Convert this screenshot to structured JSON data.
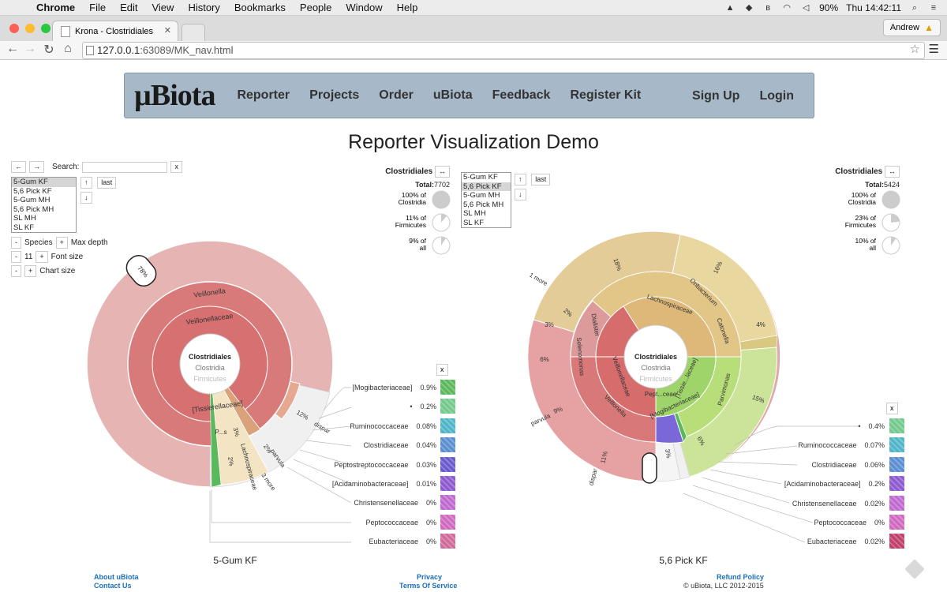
{
  "os_menubar": {
    "app": "Chrome",
    "menus": [
      "Chrome",
      "File",
      "Edit",
      "View",
      "History",
      "Bookmarks",
      "People",
      "Window",
      "Help"
    ],
    "battery": "90%",
    "clock": "Thu 14:42:11"
  },
  "browser": {
    "tab_title": "Krona - Clostridiales",
    "profile": "Andrew",
    "url_host": "127.0.0.1",
    "url_path": ":63089/MK_nav.html"
  },
  "site_nav": {
    "logo": "µBiota",
    "links": [
      "Reporter",
      "Projects",
      "Order",
      "uBiota",
      "Feedback",
      "Register Kit"
    ],
    "right_links": [
      "Sign Up",
      "Login"
    ]
  },
  "page_title": "Reporter Visualization Demo",
  "left_controls": {
    "search_label": "Search:",
    "search_value": "",
    "search_clear": "x",
    "last_button": "last",
    "datasets": [
      "5-Gum KF",
      "5,6 Pick KF",
      "5-Gum MH",
      "5,6 Pick MH",
      "SL MH",
      "SL KF"
    ],
    "species_label": "Species",
    "max_depth_label": "Max depth",
    "font_size_value": "11",
    "font_size_label": "Font size",
    "chart_size_label": "Chart size"
  },
  "left_chart": {
    "cluster": "Clostridiales",
    "total_label": "Total:",
    "total_value": "7702",
    "pie_info": [
      {
        "pct": "100% of",
        "of": "Clostridia",
        "fraction": 1.0
      },
      {
        "pct": "11% of",
        "of": "Firmicutes",
        "fraction": 0.11
      },
      {
        "pct": "9% of",
        "of": "all",
        "fraction": 0.09
      }
    ],
    "center_labels": [
      "Clostridiales",
      "Clostridia",
      "Firmicutes"
    ],
    "ring_labels": [
      "Veillonella",
      "Veillonellaceae",
      "[Tissierellaceae]",
      "P...s",
      "3%",
      "2%",
      "Lachnospiraceae",
      "2%",
      "parvula",
      "3 more",
      "12%",
      "dispar",
      "78%"
    ],
    "caption": "5-Gum KF",
    "legend_close": "x",
    "legend": [
      {
        "name": "[Mogibacteriaceae]",
        "pct": "0.9%",
        "color": "#5cb85c"
      },
      {
        "name": "•",
        "pct": "0.2%",
        "color": "#74c98d"
      },
      {
        "name": "Ruminococcaceae",
        "pct": "0.08%",
        "color": "#4fb6c9"
      },
      {
        "name": "Clostridiaceae",
        "pct": "0.04%",
        "color": "#5b8fd0"
      },
      {
        "name": "Peptostreptococcaceae",
        "pct": "0.03%",
        "color": "#6a5acd"
      },
      {
        "name": "[Acidaminobacteraceae]",
        "pct": "0.01%",
        "color": "#8e5ad0"
      },
      {
        "name": "Christensenellaceae",
        "pct": "0%",
        "color": "#c06ad0"
      },
      {
        "name": "Peptococcaceae",
        "pct": "0%",
        "color": "#d06ac0"
      },
      {
        "name": "Eubacteriaceae",
        "pct": "0%",
        "color": "#d06a9a"
      }
    ]
  },
  "right_controls": {
    "datasets": [
      "5-Gum KF",
      "5,6 Pick KF",
      "5-Gum MH",
      "5,6 Pick MH",
      "SL MH",
      "SL KF"
    ],
    "last_button": "last"
  },
  "right_chart": {
    "cluster": "Clostridiales",
    "total_label": "Total:",
    "total_value": "5424",
    "pie_info": [
      {
        "pct": "100% of",
        "of": "Clostridia",
        "fraction": 1.0
      },
      {
        "pct": "23% of",
        "of": "Firmicutes",
        "fraction": 0.23
      },
      {
        "pct": "10% of",
        "of": "all",
        "fraction": 0.1
      }
    ],
    "center_labels": [
      "Clostridiales",
      "Clostridia",
      "Firmicutes"
    ],
    "ring_labels": [
      "18%",
      "16%",
      "Oribacterium",
      "Lachnospiraceae",
      "Catonella",
      "4%",
      "Parvimonas",
      "15%",
      "6%",
      "3%",
      "2%",
      "Pept...ceae",
      "[Mogibacteriaceae]",
      "[Tissie...laceae]",
      "Veillonella",
      "Veillonellaceae",
      "Selenomonas",
      "Dialister",
      "2%",
      "3%",
      "6%",
      "9%",
      "parvula",
      "11%",
      "dispar",
      "1 more"
    ],
    "caption": "5,6 Pick KF",
    "legend_close": "x",
    "legend": [
      {
        "name": "•",
        "pct": "0.4%",
        "color": "#74c98d"
      },
      {
        "name": "Ruminococcaceae",
        "pct": "0.07%",
        "color": "#4fb6c9"
      },
      {
        "name": "Clostridiaceae",
        "pct": "0.06%",
        "color": "#5b8fd0"
      },
      {
        "name": "[Acidaminobacteraceae]",
        "pct": "0.2%",
        "color": "#8e5ad0"
      },
      {
        "name": "Christensenellaceae",
        "pct": "0.02%",
        "color": "#c06ad0"
      },
      {
        "name": "Peptococcaceae",
        "pct": "0%",
        "color": "#d06ac0"
      },
      {
        "name": "Eubacteriaceae",
        "pct": "0.02%",
        "color": "#c0406a"
      }
    ]
  },
  "footer": {
    "about": "About uBiota",
    "contact": "Contact Us",
    "privacy": "Privacy",
    "terms": "Terms Of Service",
    "refund": "Refund Policy",
    "copyright": "© uBiota, LLC 2012-2015"
  }
}
